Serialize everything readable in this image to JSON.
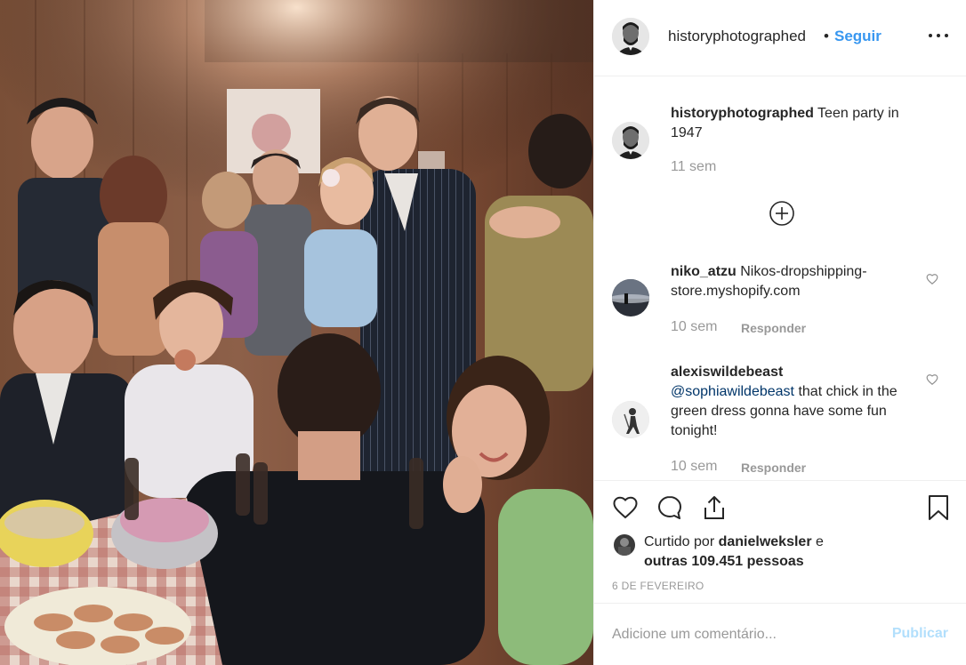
{
  "post": {
    "username": "historyphotographed",
    "separator": "•",
    "follow_label": "Seguir",
    "more_icon": "more-options-icon"
  },
  "caption": {
    "username": "historyphotographed",
    "text": " Teen party in 1947",
    "time": "11 sem"
  },
  "load_more_icon": "plus-circle-icon",
  "comments": [
    {
      "username": "niko_atzu",
      "text": " Nikos-dropshipping-store.myshopify.com",
      "time": "10 sem",
      "reply_label": "Responder"
    },
    {
      "username": "alexiswildebeast",
      "mention": "@sophiawildebeast",
      "text": " that chick in the green dress gonna have some fun tonight!",
      "time": "10 sem",
      "reply_label": "Responder"
    }
  ],
  "actions": {
    "like_icon": "heart-icon",
    "comment_icon": "comment-icon",
    "share_icon": "share-icon",
    "save_icon": "bookmark-icon"
  },
  "likes": {
    "prefix": "Curtido por ",
    "user": "danielweksler",
    "middle": " e ",
    "others": "outras 109.451 pessoas"
  },
  "date": "6 DE FEVEREIRO",
  "add_comment": {
    "placeholder": "Adicione um comentário...",
    "publish_label": "Publicar"
  },
  "colors": {
    "link_blue": "#3897f0",
    "publish_disabled": "#b2dffc",
    "muted_gray": "#999999",
    "text": "#262626"
  }
}
